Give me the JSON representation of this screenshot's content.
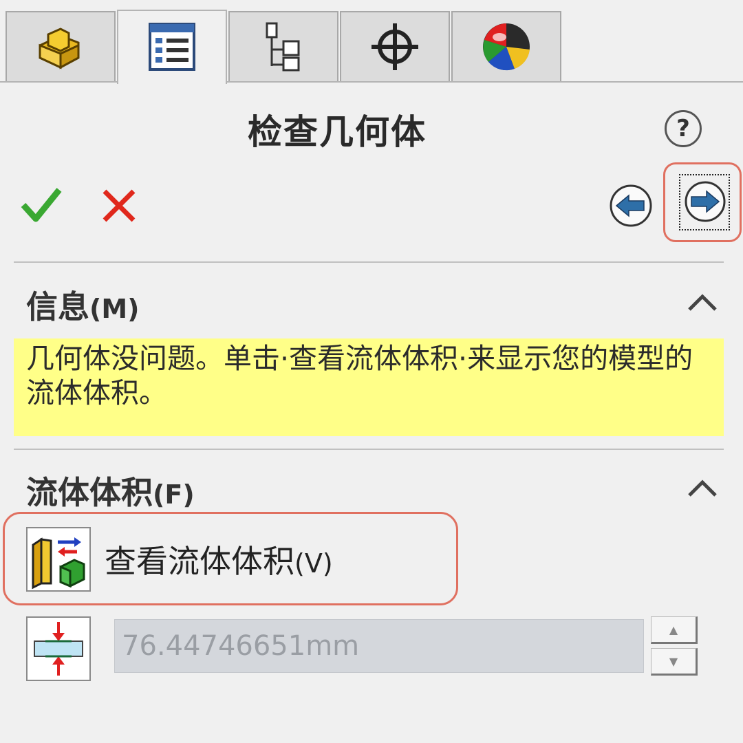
{
  "tabs": [
    {
      "name": "featuremanager-tab",
      "icon": "part-icon",
      "active": false
    },
    {
      "name": "propertymanager-tab",
      "icon": "property-list-icon",
      "active": true
    },
    {
      "name": "configurationmanager-tab",
      "icon": "configuration-tree-icon",
      "active": false
    },
    {
      "name": "dimxpertmanager-tab",
      "icon": "crosshair-icon",
      "active": false
    },
    {
      "name": "displaymanager-tab",
      "icon": "display-sphere-icon",
      "active": false
    }
  ],
  "title": "检查几何体",
  "help_glyph": "?",
  "info": {
    "header": "信息",
    "header_key": "(M)",
    "message": "几何体没问题。单击·查看流体体积·来显示您的模型的流体体积。"
  },
  "fluid_volume": {
    "header": "流体体积",
    "header_key": "(F)",
    "view_button_label": "查看流体体积",
    "view_button_key": "(V)",
    "tolerance_value": "76.44746651mm",
    "spin_up": "▲",
    "spin_down": "▼"
  },
  "colors": {
    "ok_green": "#3aa832",
    "cancel_red": "#e0281c",
    "message_bg": "#ffff88",
    "highlight": "#e07060"
  }
}
